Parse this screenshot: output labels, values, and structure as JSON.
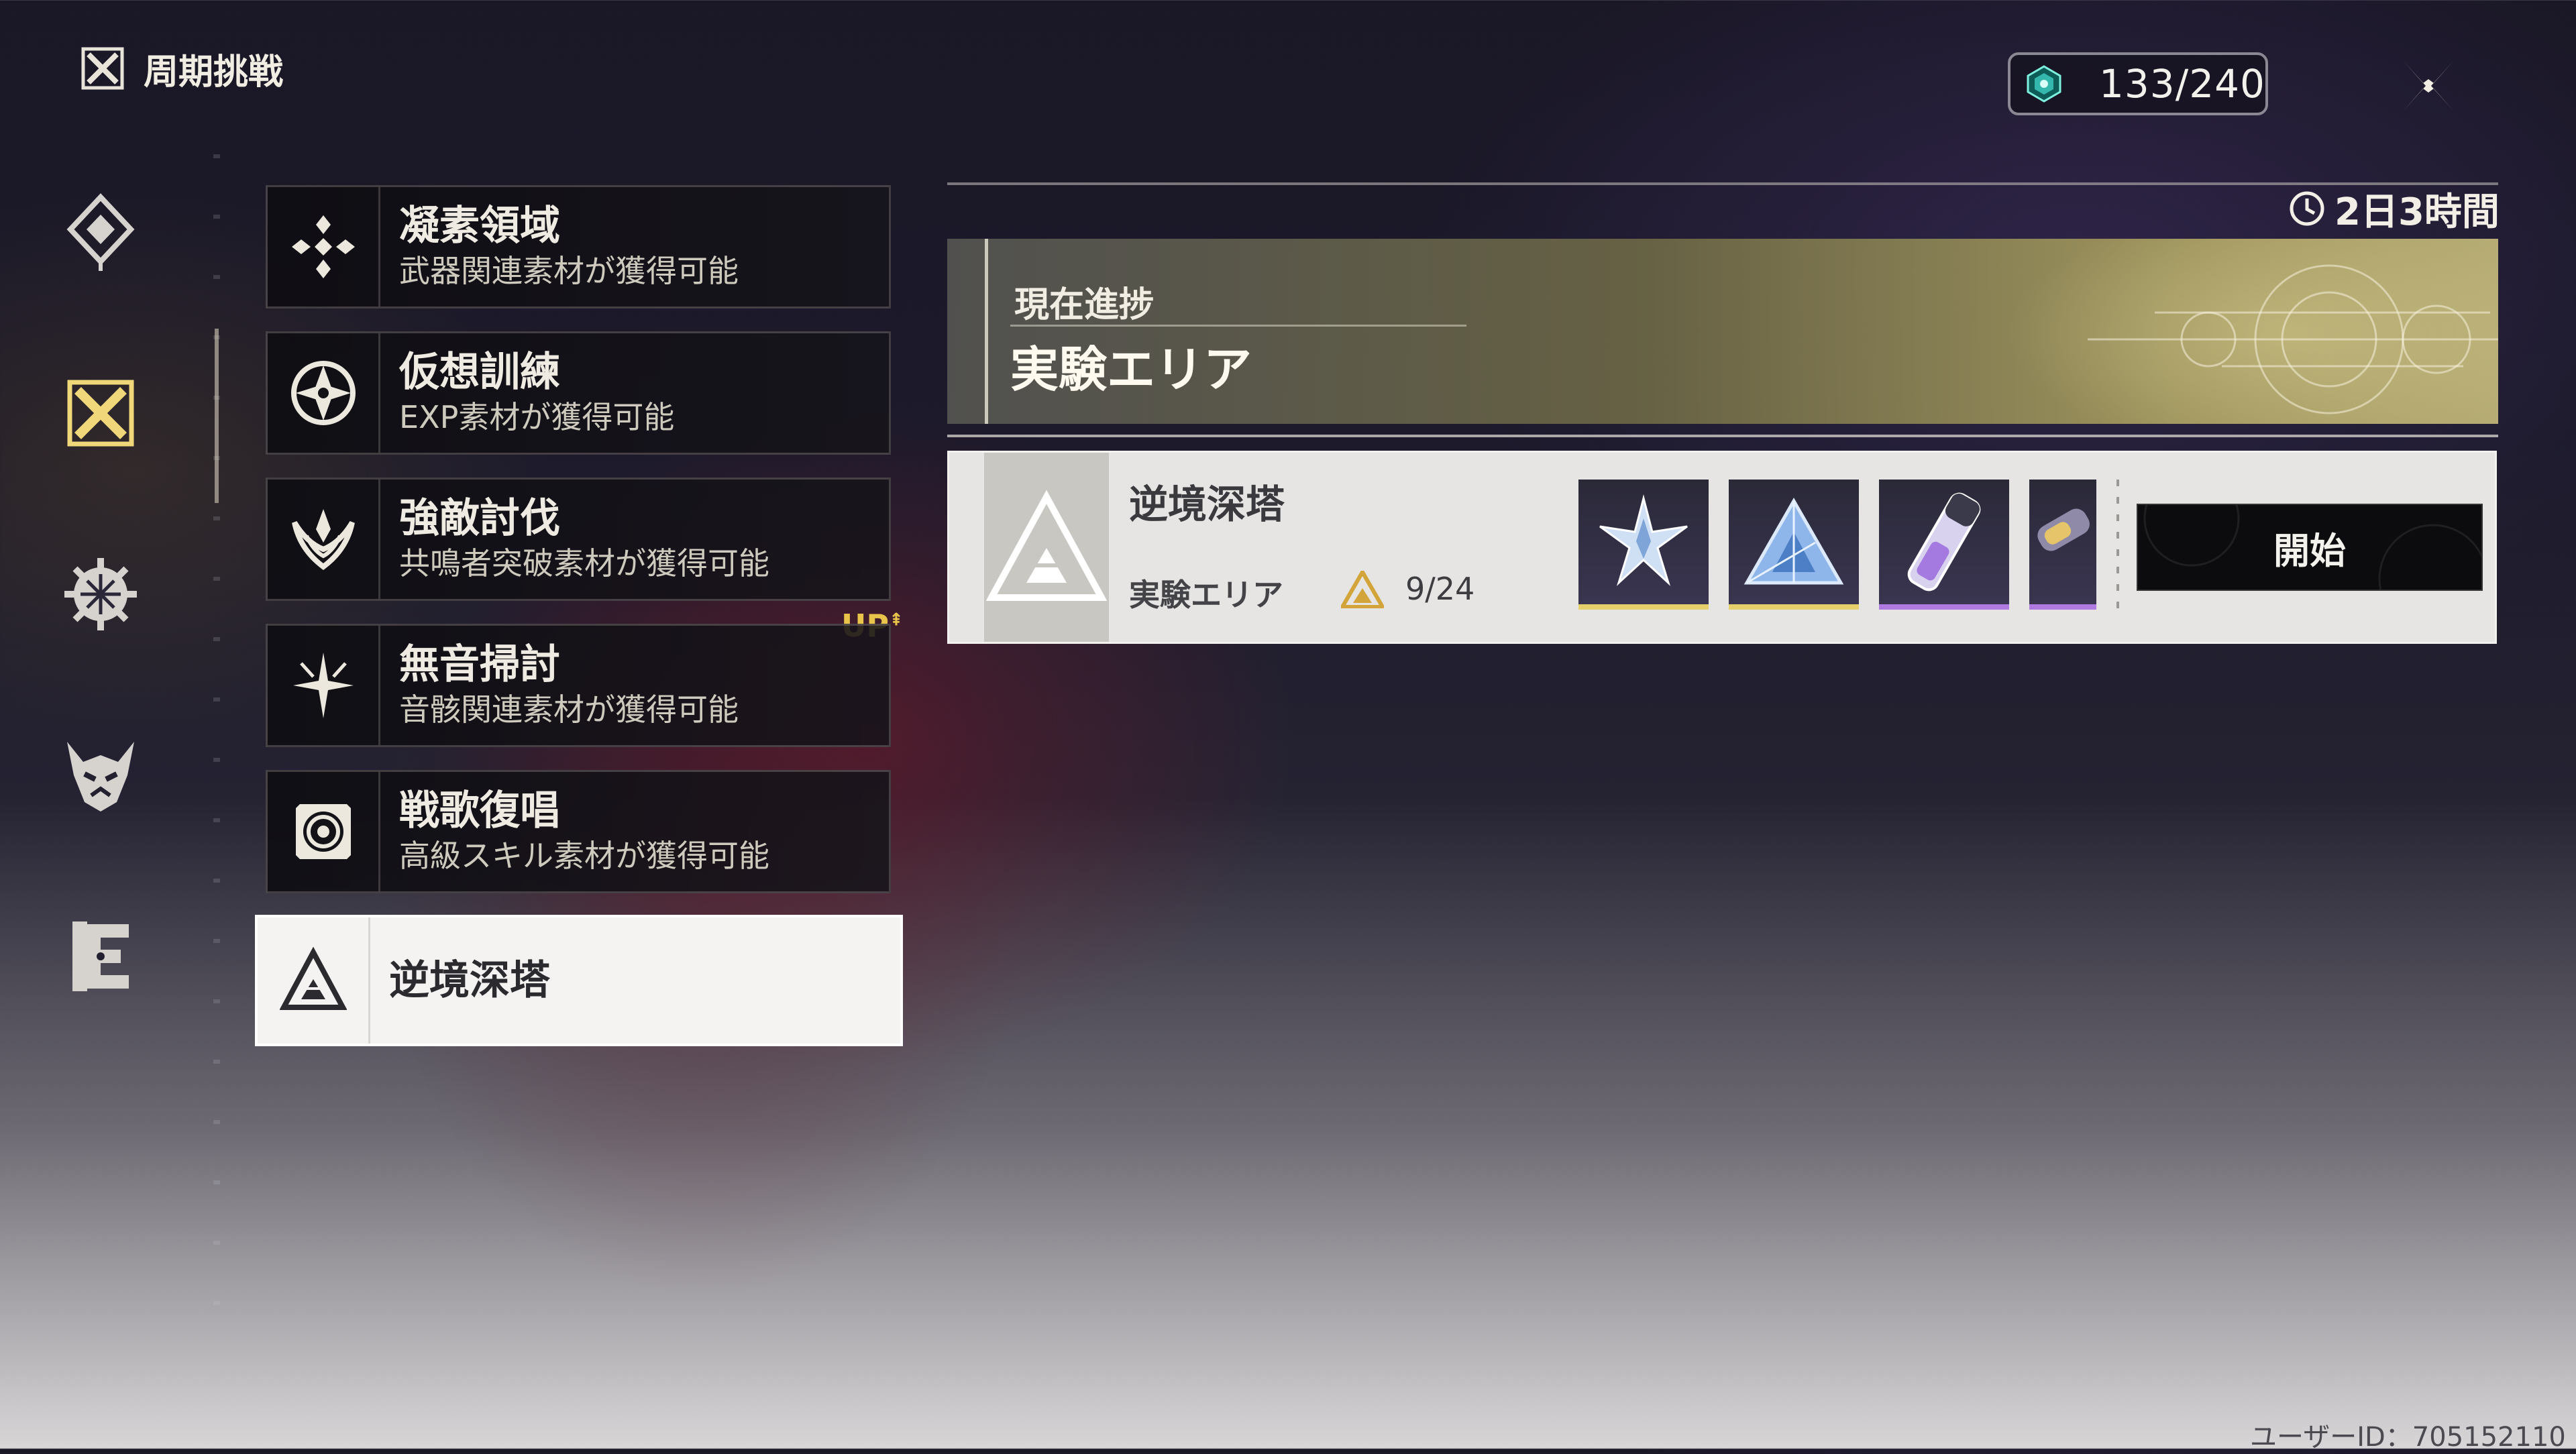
{
  "header": {
    "title": "周期挑戦",
    "stamina": "133/240",
    "close_icon": "close-x-icon"
  },
  "nav": {
    "items": [
      {
        "icon": "diamond-rune-icon",
        "active": false
      },
      {
        "icon": "crossed-x-icon",
        "active": true
      },
      {
        "icon": "snowflake-gear-icon",
        "active": false
      },
      {
        "icon": "demon-mask-icon",
        "active": false
      },
      {
        "icon": "tower-gate-icon",
        "active": false
      }
    ]
  },
  "challenges": [
    {
      "name": "凝素領域",
      "desc": "武器関連素材が獲得可能",
      "icon": "diamond-cluster-icon"
    },
    {
      "name": "仮想訓練",
      "desc": "EXP素材が獲得可能",
      "icon": "compass-emblem-icon"
    },
    {
      "name": "強敵討伐",
      "desc": "共鳴者突破素材が獲得可能",
      "icon": "flame-crest-icon"
    },
    {
      "name": "無音掃討",
      "desc": "音骸関連素材が獲得可能",
      "icon": "sparkle-star-icon"
    },
    {
      "name": "戦歌復唱",
      "desc": "高級スキル素材が獲得可能",
      "icon": "target-ring-icon"
    },
    {
      "name": "逆境深塔",
      "desc": "",
      "icon": "triangle-tower-icon",
      "active": true
    }
  ],
  "up_badge": "UP",
  "panel": {
    "timer": "2日3時間",
    "progress_label": "現在進捗",
    "progress_area": "実験エリア",
    "detail": {
      "title": "逆境深塔",
      "area": "実験エリア",
      "progress": "9/24",
      "rewards": [
        {
          "icon": "crystal-star-icon",
          "rarity": "gold"
        },
        {
          "icon": "prism-triangle-icon",
          "rarity": "gold"
        },
        {
          "icon": "vial-capsule-icon",
          "rarity": "purple"
        },
        {
          "icon": "partial-item-icon",
          "rarity": "purple"
        }
      ],
      "start": "開始"
    }
  },
  "footer": {
    "user_id": "ユーザーID：705152110"
  },
  "colors": {
    "accent_gold": "#e5cf6a",
    "accent_purple": "#b07be0",
    "up_badge": "#e8c44a"
  }
}
